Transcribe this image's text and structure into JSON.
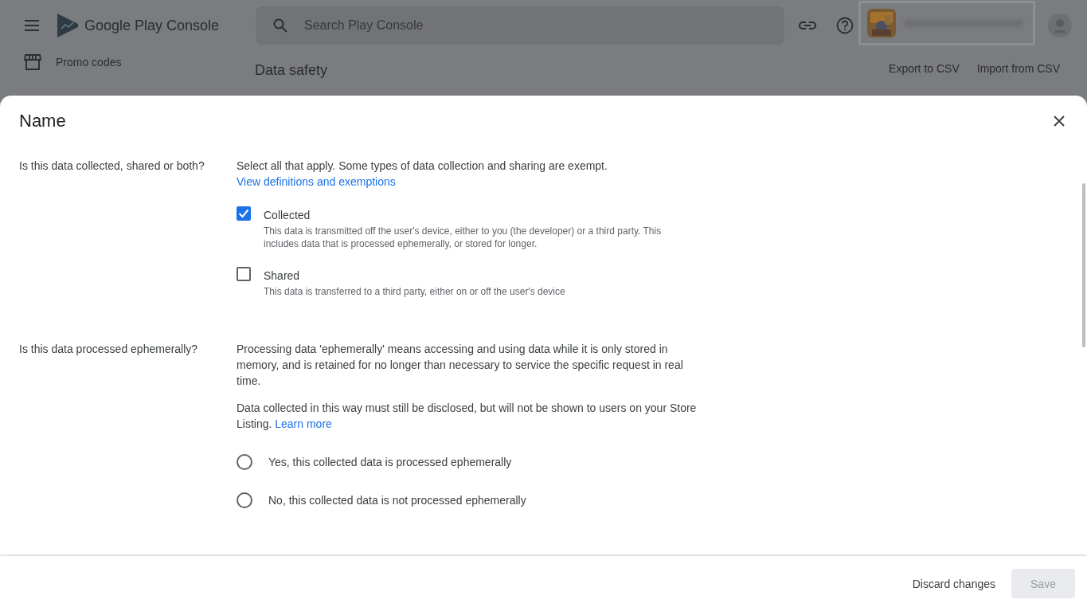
{
  "app_bar": {
    "product_name_bold": "Google Play",
    "product_name": "Console",
    "search": {
      "placeholder": "Search Play Console"
    }
  },
  "sidebar": {
    "items": [
      {
        "label": "Promo codes",
        "kind": "store"
      }
    ]
  },
  "page": {
    "title": "Data safety",
    "actions": [
      "Export to CSV",
      "Import from CSV"
    ]
  },
  "dialog": {
    "title": "Name",
    "sections": [
      {
        "kind": "checkboxes",
        "question": "Is this data collected, shared or both?",
        "paragraphs": [
          {
            "text": "Select all that apply. Some types of data collection and sharing are exempt."
          }
        ],
        "link": "View definitions and exemptions",
        "options": [
          {
            "label": "Collected",
            "description": "This data is transmitted off the user's device, either to you (the developer) or a third party. This includes data that is processed ephemerally, or stored for longer.",
            "checked": true
          },
          {
            "label": "Shared",
            "description": "This data is transferred to a third party, either on or off the user's device",
            "checked": false
          }
        ]
      },
      {
        "kind": "radios",
        "question": "Is this data processed ephemerally?",
        "paragraphs": [
          {
            "text": "Processing data 'ephemerally' means accessing and using data while it is only stored in memory, and is retained for no longer than necessary to service the specific request in real time."
          },
          {
            "text": "Data collected in this way must still be disclosed, but will not be shown to users on your Store Listing.",
            "link": "Learn more"
          }
        ],
        "options": [
          {
            "label": "Yes, this collected data is processed ephemerally",
            "selected": false
          },
          {
            "label": "No, this collected data is not processed ephemerally",
            "selected": false
          }
        ]
      }
    ],
    "buttons": [
      {
        "label": "Discard changes",
        "disabled": false
      },
      {
        "label": "Save",
        "disabled": true
      }
    ]
  }
}
